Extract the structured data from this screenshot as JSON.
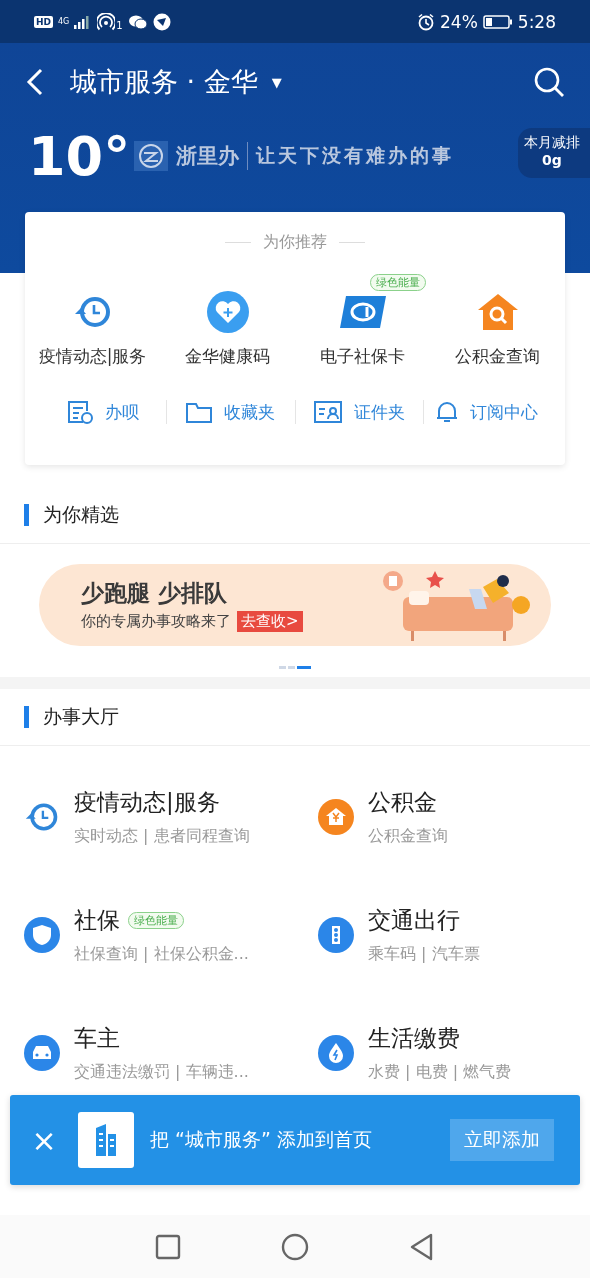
{
  "status_bar": {
    "hd": "HD",
    "network": "4G",
    "notification_count": "1",
    "battery_percent": "24%",
    "time": "5:28"
  },
  "header": {
    "title": "城市服务 · 金华",
    "dropdown": "▼",
    "temperature": "10°",
    "slogan_brand": "浙里办",
    "slogan": "让天下没有难办的事",
    "emission_label": "本月减排",
    "emission_value": "0g"
  },
  "recommend": {
    "title": "为你推荐",
    "items": [
      {
        "label": "疫情动态|服务"
      },
      {
        "label": "金华健康码"
      },
      {
        "label": "电子社保卡",
        "badge": "绿色能量"
      },
      {
        "label": "公积金查询"
      }
    ],
    "shortcuts": [
      {
        "label": "办呗"
      },
      {
        "label": "收藏夹"
      },
      {
        "label": "证件夹"
      },
      {
        "label": "订阅中心"
      }
    ]
  },
  "featured": {
    "title": "为你精选",
    "banner": {
      "headline": "少跑腿 少排队",
      "subline": "你的专属办事攻略来了",
      "action": "去查收>"
    },
    "pages": [
      {
        "selected": false
      },
      {
        "selected": false
      },
      {
        "selected": true
      }
    ]
  },
  "hall": {
    "title": "办事大厅",
    "items": [
      {
        "title": "疫情动态|服务",
        "subtitle": "实时动态 | 患者同程查询"
      },
      {
        "title": "公积金",
        "subtitle": "公积金查询"
      },
      {
        "title": "社保",
        "badge": "绿色能量",
        "subtitle": "社保查询 | 社保公积金..."
      },
      {
        "title": "交通出行",
        "subtitle": "乘车码 | 汽车票"
      },
      {
        "title": "车主",
        "subtitle": "交通违法缴罚 | 车辆违..."
      },
      {
        "title": "生活缴费",
        "subtitle": "水费 | 电费 | 燃气费"
      }
    ]
  },
  "toast": {
    "close": "×",
    "message": "把 “城市服务” 添加到首页",
    "action": "立即添加"
  }
}
